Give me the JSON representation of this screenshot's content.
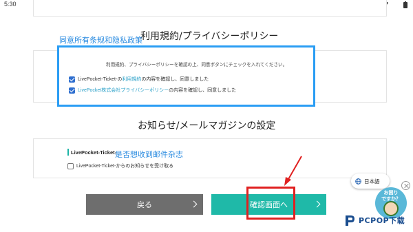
{
  "status_bar": {
    "time": "5:30"
  },
  "terms_section": {
    "title": "利用規約/プライバシーポリシー",
    "annotation": "同意所有条规和隐私政策",
    "note": "利用規約、プライバシーポリシーを確認の上、同意ボタンにチェックを入れてください。",
    "checkbox_1": {
      "prefix": "LivePocket-Ticket-の",
      "link": "利用規約",
      "suffix": "の内容を確認し、同意しました",
      "checked": true
    },
    "checkbox_2": {
      "link": "LivePocket株式会社プライバシーポリシー",
      "suffix": "の内容を確認し、同意しました",
      "checked": true
    }
  },
  "mail_section": {
    "title": "お知らせ/メールマガジンの設定",
    "label": "LivePocket-Ticket-",
    "annotation": "是否想收到邮件杂志",
    "checkbox": {
      "label": "LivePocket-Ticket-からのお知らせを受け取る",
      "checked": false
    }
  },
  "buttons": {
    "back": "戻る",
    "confirm": "確認画面へ"
  },
  "language": {
    "label": "日本語"
  },
  "help_widget": {
    "line1": "お困り",
    "line2": "ですか？"
  },
  "watermark": {
    "text": "PCPOP下载"
  },
  "colors": {
    "accent_teal": "#1fb9a8",
    "annotation_blue": "#2a9df4",
    "highlight_red": "#e02020",
    "back_gray": "#6e6e6e"
  }
}
